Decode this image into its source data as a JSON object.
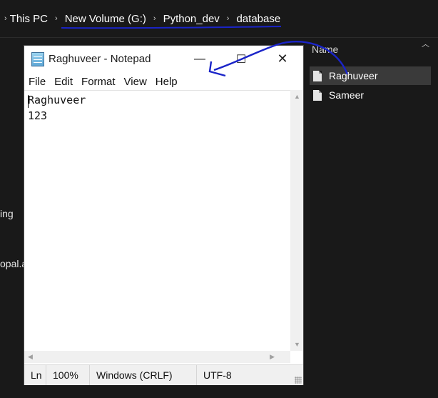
{
  "breadcrumb": {
    "items": [
      "This PC",
      "New Volume (G:)",
      "Python_dev",
      "database"
    ],
    "separator": "›"
  },
  "left_pane": {
    "fragments": [
      "ing",
      "opal.a"
    ]
  },
  "file_list": {
    "column_header": "Name",
    "files": [
      {
        "name": "Raghuveer",
        "selected": true
      },
      {
        "name": "Sameer",
        "selected": false
      }
    ]
  },
  "notepad": {
    "title": "Raghuveer - Notepad",
    "menu": [
      "File",
      "Edit",
      "Format",
      "View",
      "Help"
    ],
    "content_lines": [
      "Raghuveer",
      "123"
    ],
    "status": {
      "position": "Ln",
      "zoom": "100%",
      "line_ending": "Windows (CRLF)",
      "encoding": "UTF-8"
    }
  },
  "colors": {
    "annotation": "#1a24c8",
    "explorer_bg": "#191919"
  }
}
